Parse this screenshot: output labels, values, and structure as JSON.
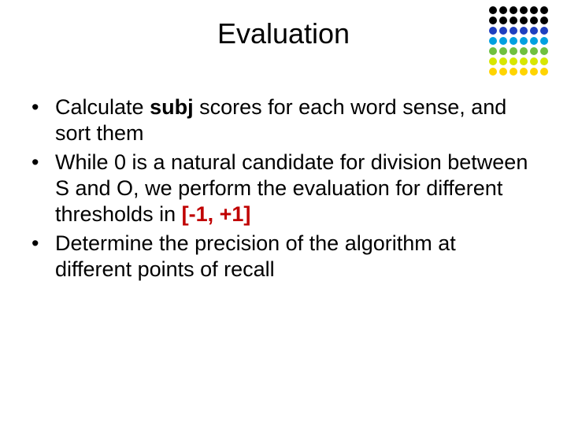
{
  "title": "Evaluation",
  "bullets": {
    "b1": {
      "t1": "Calculate ",
      "subj": "subj",
      "t2": " scores for each word sense, and sort them"
    },
    "b2": {
      "t1": "While 0 is a natural candidate for division between S and O, we perform the evaluation for different thresholds in ",
      "range": "[-1, +1]"
    },
    "b3": {
      "t1": "Determine the precision of the algorithm at different points of recall"
    }
  },
  "dot_colors": {
    "r1": "#000000",
    "r2": "#000000",
    "r3": "#1f3fbf",
    "r4": "#00a0e0",
    "r5": "#6fc03f",
    "r6": "#d7e600",
    "r7": "#ffd400"
  }
}
